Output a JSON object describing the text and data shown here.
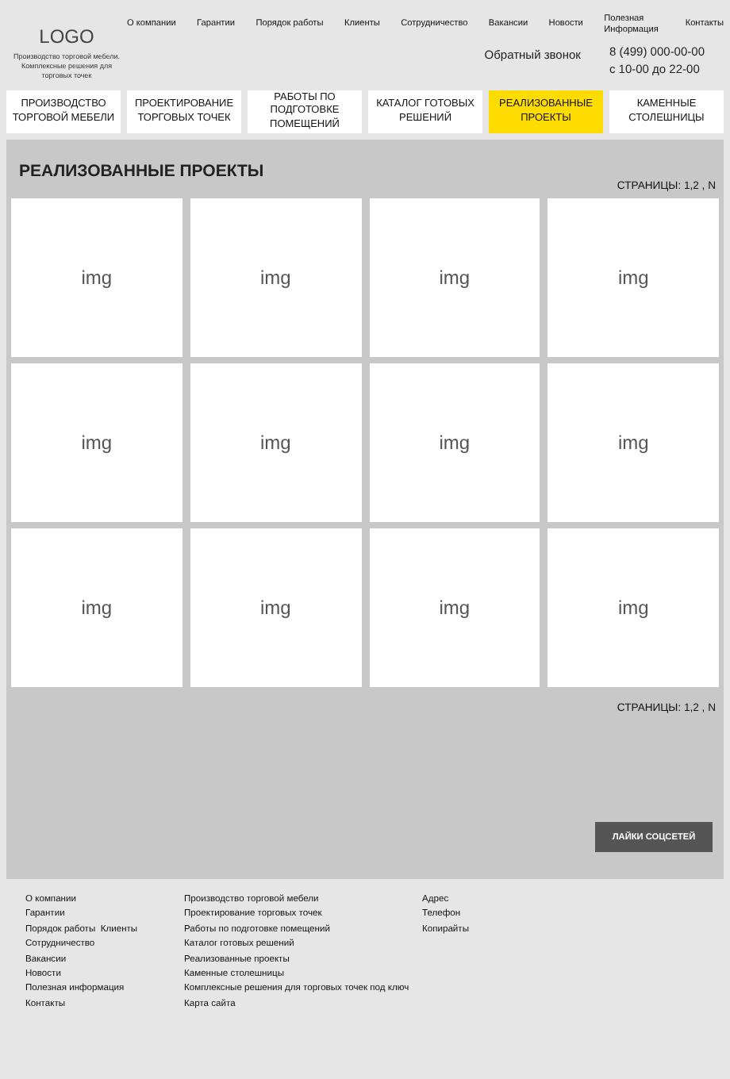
{
  "logo": {
    "text": "LOGO",
    "tagline": "Производство торговой мебели. Комплексные решения для торговых точек"
  },
  "top_menu": [
    "О компании",
    "Гарантии",
    "Порядок работы",
    "Клиенты",
    "Сотрудничество",
    "Вакансии",
    "Новости",
    "Полезная Информация",
    "Контакты"
  ],
  "callback": "Обратный звонок",
  "phone": "8 (499) 000-00-00",
  "hours": "с 10-00 до 22-00",
  "tabs": [
    {
      "label": "ПРОИЗВОДСТВО ТОРГОВОЙ МЕБЕЛИ",
      "selected": false
    },
    {
      "label": "ПРОЕКТИРОВАНИЕ ТОРГОВЫХ ТОЧЕК",
      "selected": false
    },
    {
      "label": "РАБОТЫ ПО ПОДГОТОВКЕ ПОМЕЩЕНИЙ",
      "selected": false
    },
    {
      "label": "КАТАЛОГ ГОТОВЫХ РЕШЕНИЙ",
      "selected": false
    },
    {
      "label": "РЕАЛИЗОВАННЫЕ ПРОЕКТЫ",
      "selected": true
    },
    {
      "label": "КАМЕННЫЕ СТОЛЕШНИЦЫ",
      "selected": false
    }
  ],
  "section": {
    "title": "РЕАЛИЗОВАННЫЕ ПРОЕКТЫ",
    "pages_top": "СТРАНИЦЫ: 1,2 , N",
    "cards": [
      "img",
      "img",
      "img",
      "img",
      "img",
      "img",
      "img",
      "img",
      "img",
      "img",
      "img",
      "img"
    ],
    "pages_bottom": "СТРАНИЦЫ: 1,2 , N",
    "social_button": "ЛАЙКИ СОЦСЕТЕЙ"
  },
  "footer": {
    "column_1": [
      "О компании",
      "Гарантии",
      "Порядок работы  Клиенты",
      "Сотрудничество",
      "Вакансии",
      "Новости",
      "Полезная информация",
      "Контакты"
    ],
    "column_2": [
      "Производство торговой мебели",
      "Проектирование торговых точек",
      "Работы по подготовке помещений",
      "Каталог готовых решений",
      "Реализованные проекты",
      "Каменные столешницы",
      "Комплексные решения для торговых точек под ключ",
      "Карта сайта"
    ],
    "column_3": [
      "Адрес",
      "Телефон",
      "Копирайты"
    ]
  }
}
